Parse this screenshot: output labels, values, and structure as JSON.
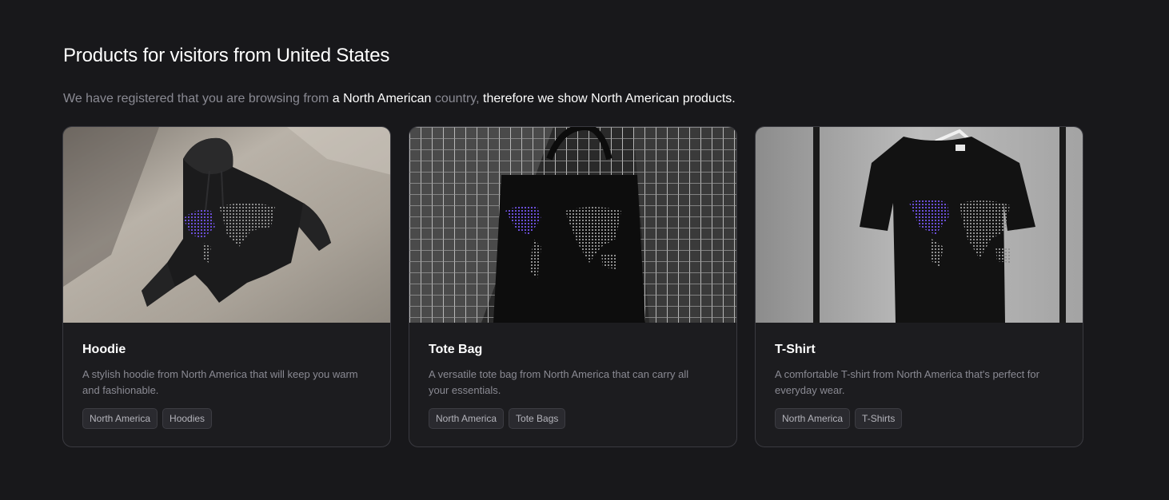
{
  "header": {
    "title": "Products for visitors from United States",
    "subtitle_part1": "We have registered that you are browsing from ",
    "subtitle_highlight1": "a North American",
    "subtitle_part2": " country, ",
    "subtitle_highlight2": "therefore we show North American products."
  },
  "products": [
    {
      "name": "Hoodie",
      "description": "A stylish hoodie from North America that will keep you warm and fashionable.",
      "tags": [
        "North America",
        "Hoodies"
      ],
      "image": "hoodie-product-photo"
    },
    {
      "name": "Tote Bag",
      "description": "A versatile tote bag from North America that can carry all your essentials.",
      "tags": [
        "North America",
        "Tote Bags"
      ],
      "image": "tote-bag-product-photo"
    },
    {
      "name": "T-Shirt",
      "description": "A comfortable T-shirt from North America that's perfect for everyday wear.",
      "tags": [
        "North America",
        "T-Shirts"
      ],
      "image": "tshirt-product-photo"
    }
  ],
  "colors": {
    "background": "#18181b",
    "card": "#1c1c1f",
    "accent_map": "#6b4fd8",
    "muted_text": "#8a8a93"
  }
}
